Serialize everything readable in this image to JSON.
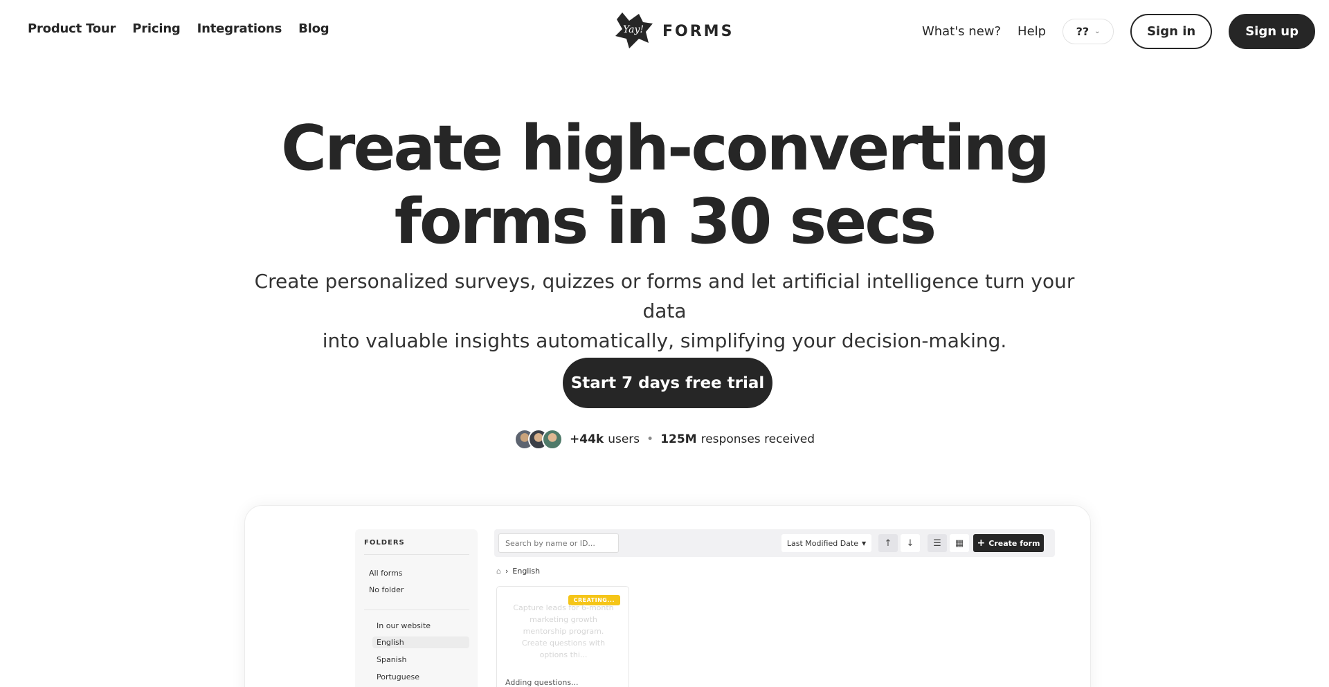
{
  "nav": {
    "left": [
      "Product Tour",
      "Pricing",
      "Integrations",
      "Blog"
    ],
    "logo_mark_text": "Yay!",
    "logo_text": "FORMS",
    "whats_new": "What's new?",
    "help": "Help",
    "language": "??",
    "sign_in": "Sign in",
    "sign_up": "Sign up"
  },
  "hero": {
    "title_line1": "Create high-converting",
    "title_line2": "forms in 30 secs",
    "subtitle_line1": "Create personalized surveys, quizzes or forms and let artificial intelligence turn your data",
    "subtitle_line2": "into valuable insights automatically, simplifying your decision-making.",
    "cta": "Start 7 days free trial"
  },
  "social_proof": {
    "users_count": "+44k",
    "users_label": "users",
    "separator": "•",
    "responses_count": "125M",
    "responses_label": "responses received"
  },
  "preview": {
    "folders_title": "FOLDERS",
    "folders": [
      "All forms",
      "No folder"
    ],
    "subfolders": [
      "In our website",
      "English",
      "Spanish",
      "Portuguese"
    ],
    "search_placeholder": "Search by name or ID...",
    "sort_label": "Last Modified Date",
    "create_label": "Create form",
    "breadcrumb_current": "English",
    "badge": "CREATING...",
    "faded_text": "Capture leads for 6-month marketing growth mentorship program. Create questions with options thi...",
    "adding_text": "Adding questions..."
  },
  "colors": {
    "ink": "#262626",
    "badge_yellow": "#f5c518",
    "panel_grey": "#f1f1f3"
  }
}
